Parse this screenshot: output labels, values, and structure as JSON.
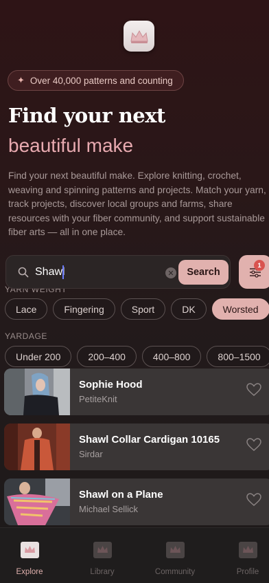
{
  "banner": {
    "text": "Over 40,000 patterns and counting"
  },
  "hero": {
    "title_line1": "Find your next",
    "title_line2": "beautiful make",
    "description": "Find your next beautiful make. Explore knitting, crochet, weaving and spinning patterns and projects. Match your yarn, track projects, discover local groups and farms, share resources with your fiber community, and support sustainable fiber arts — all in one place."
  },
  "search": {
    "value": "Shawl",
    "button_label": "Search",
    "filter_badge": "1"
  },
  "filters": {
    "yarn_weight_label": "YARN WEIGHT",
    "yarn_weights": [
      "Lace",
      "Fingering",
      "Sport",
      "DK",
      "Worsted"
    ],
    "active_yarn_weight": "Worsted",
    "yardage_label": "YARDAGE",
    "yardages": [
      "Under 200",
      "200–400",
      "400–800",
      "800–1500"
    ]
  },
  "results": [
    {
      "title": "Sophie Hood",
      "author": "PetiteKnit"
    },
    {
      "title": "Shawl Collar Cardigan 10165",
      "author": "Sirdar"
    },
    {
      "title": "Shawl on a Plane",
      "author": "Michael Sellick"
    }
  ],
  "tabs": [
    {
      "label": "Explore",
      "active": true
    },
    {
      "label": "Library",
      "active": false
    },
    {
      "label": "Community",
      "active": false
    },
    {
      "label": "Profile",
      "active": false
    }
  ],
  "colors": {
    "accent": "#e1b1ae",
    "title_pink": "#e8aab0",
    "background": "#231a1b"
  }
}
